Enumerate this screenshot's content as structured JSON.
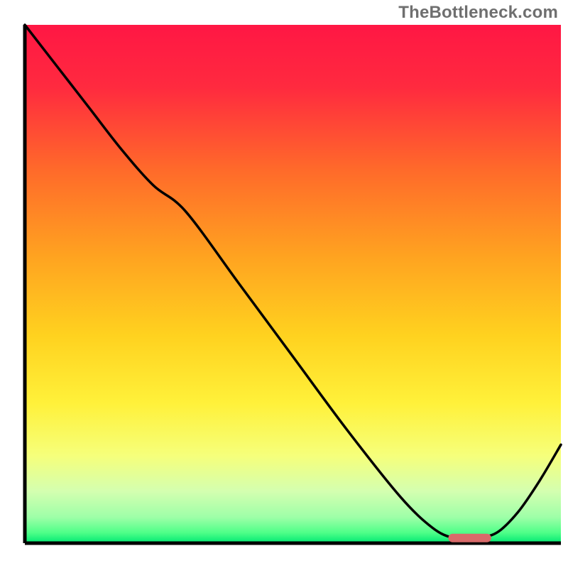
{
  "watermark": "TheBottleneck.com",
  "chart_data": {
    "type": "line",
    "title": "",
    "xlabel": "",
    "ylabel": "",
    "xlim": [
      0,
      100
    ],
    "ylim": [
      0,
      100
    ],
    "series": [
      {
        "name": "curve",
        "x": [
          0,
          6,
          12,
          18,
          24,
          30,
          40,
          50,
          60,
          70,
          76,
          80,
          84,
          88,
          92,
          96,
          100
        ],
        "y": [
          100,
          92,
          84,
          76,
          69,
          64,
          50,
          36,
          22,
          9,
          3,
          1,
          1,
          2,
          6,
          12,
          19
        ]
      }
    ],
    "marker_segment": {
      "x_start": 79,
      "x_end": 87,
      "y": 1
    },
    "gradient_stops": [
      {
        "pos": 0.0,
        "color": "#ff1744"
      },
      {
        "pos": 0.12,
        "color": "#ff2a3f"
      },
      {
        "pos": 0.28,
        "color": "#ff6a2a"
      },
      {
        "pos": 0.45,
        "color": "#ffa420"
      },
      {
        "pos": 0.6,
        "color": "#ffd21f"
      },
      {
        "pos": 0.73,
        "color": "#fff13a"
      },
      {
        "pos": 0.83,
        "color": "#f6ff7a"
      },
      {
        "pos": 0.9,
        "color": "#d4ffb0"
      },
      {
        "pos": 0.95,
        "color": "#9effa8"
      },
      {
        "pos": 0.98,
        "color": "#4eff88"
      },
      {
        "pos": 1.0,
        "color": "#00e873"
      }
    ]
  }
}
